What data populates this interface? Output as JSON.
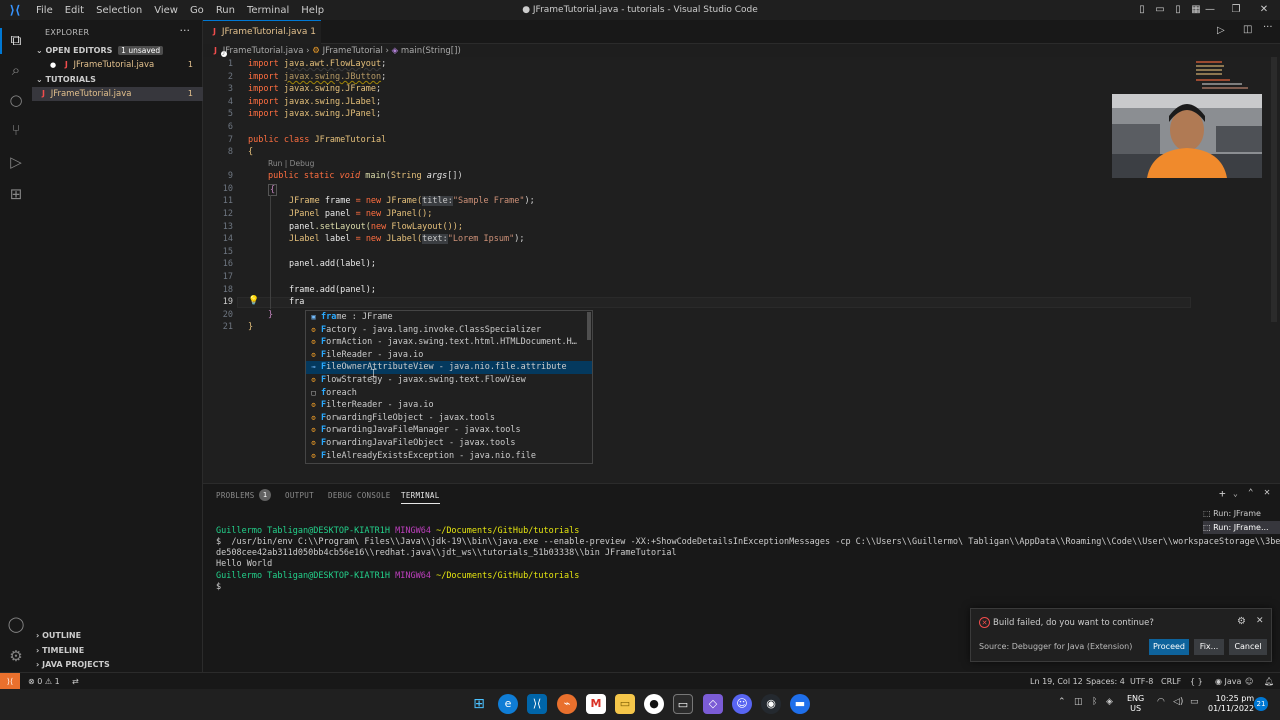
{
  "window": {
    "title": "● JFrameTutorial.java - tutorials - Visual Studio Code",
    "menu": [
      "File",
      "Edit",
      "Selection",
      "View",
      "Go",
      "Run",
      "Terminal",
      "Help"
    ]
  },
  "sidebar": {
    "header": "EXPLORER",
    "open_editors_label": "OPEN EDITORS",
    "unsaved_badge": "1 unsaved",
    "open_file": "JFrameTutorial.java",
    "open_file_problems": "1",
    "folder_label": "TUTORIALS",
    "tree_file": "JFrameTutorial.java",
    "tree_file_problems": "1",
    "outline_label": "OUTLINE",
    "timeline_label": "TIMELINE",
    "java_projects_label": "JAVA PROJECTS"
  },
  "tab": {
    "label": "JFrameTutorial.java 1"
  },
  "breadcrumbs": {
    "file": "JFrameTutorial.java",
    "class": "JFrameTutorial",
    "method": "main(String[])"
  },
  "editor": {
    "codelens": "Run | Debug",
    "lines": {
      "l1": {
        "kw": "import",
        "pkg": "java.awt.FlowLayout",
        "semi": ";"
      },
      "l2": {
        "kw": "import",
        "pkg": "javax.swing.JButton",
        "semi": ";"
      },
      "l3": {
        "kw": "import",
        "pkg": "javax.swing.JFrame",
        "semi": ";"
      },
      "l4": {
        "kw": "import",
        "pkg": "javax.swing.JLabel",
        "semi": ";"
      },
      "l5": {
        "kw": "import",
        "pkg": "javax.swing.JPanel",
        "semi": ";"
      },
      "l7": {
        "kw": "public class",
        "name": "JFrameTutorial"
      },
      "l8": "{",
      "l9": {
        "kw": "public static",
        "kw2": "void",
        "fn": "main",
        "open": "(",
        "type": "String",
        "param": "args",
        "close": "[])"
      },
      "l10": "{",
      "l11": {
        "type": "JFrame",
        "var": "frame",
        "op": "=",
        "kw": "new",
        "ctor": "JFrame(",
        "hint": "title:",
        "str": "\"Sample Frame\"",
        "end": ");"
      },
      "l12": {
        "type": "JPanel",
        "var": "panel",
        "op": "=",
        "kw": "new",
        "ctor": "JPanel();"
      },
      "l13": {
        "var": "panel",
        "call": ".setLayout(",
        "kw": "new",
        "ctor": "FlowLayout());"
      },
      "l14": {
        "type": "JLabel",
        "var": "label",
        "op": "=",
        "kw": "new",
        "ctor": "JLabel(",
        "hint": "text:",
        "str": "\"Lorem Ipsum\"",
        "end": ");"
      },
      "l16": "panel.add(label);",
      "l18": "frame.add(panel);",
      "l19": "fra",
      "l20": "}",
      "l21": "}"
    },
    "line_numbers": [
      "1",
      "2",
      "3",
      "4",
      "5",
      "6",
      "7",
      "8",
      "9",
      "10",
      "11",
      "12",
      "13",
      "14",
      "15",
      "16",
      "17",
      "18",
      "19",
      "20",
      "21"
    ]
  },
  "suggestions": [
    {
      "icon": "variable-icon",
      "match": "fra",
      "rest": "me : JFrame",
      "glyph": "▣"
    },
    {
      "icon": "class-icon",
      "match": "F",
      "rest": "actory - java.lang.invoke.ClassSpecializer",
      "glyph": "⚙"
    },
    {
      "icon": "class-icon",
      "match": "F",
      "rest": "ormAction - javax.swing.text.html.HTMLDocument.H…",
      "glyph": "⚙"
    },
    {
      "icon": "class-icon",
      "match": "F",
      "rest": "ileReader - java.io",
      "glyph": "⚙"
    },
    {
      "icon": "interface-icon",
      "match": "F",
      "rest": "ileOwnerAttributeView - java.nio.file.attribute",
      "glyph": "⊸"
    },
    {
      "icon": "class-icon",
      "match": "F",
      "rest": "lowStrategy - javax.swing.text.FlowView",
      "glyph": "⚙"
    },
    {
      "icon": "snippet-icon",
      "match": "f",
      "rest": "oreach",
      "glyph": "□"
    },
    {
      "icon": "class-icon",
      "match": "F",
      "rest": "ilterReader - java.io",
      "glyph": "⚙"
    },
    {
      "icon": "class-icon",
      "match": "F",
      "rest": "orwardingFileObject - javax.tools",
      "glyph": "⚙"
    },
    {
      "icon": "class-icon",
      "match": "F",
      "rest": "orwardingJavaFileManager - javax.tools",
      "glyph": "⚙"
    },
    {
      "icon": "class-icon",
      "match": "F",
      "rest": "orwardingJavaFileObject - javax.tools",
      "glyph": "⚙"
    },
    {
      "icon": "class-icon",
      "match": "F",
      "rest": "ileAlreadyExistsException - java.nio.file",
      "glyph": "⚙"
    }
  ],
  "panel": {
    "tabs": {
      "problems": "PROBLEMS",
      "problems_count": "1",
      "output": "OUTPUT",
      "debug": "DEBUG CONSOLE",
      "terminal": "TERMINAL"
    },
    "terminal_sessions": [
      "Run: JFrame",
      "Run: JFrame..."
    ],
    "terminal": {
      "p1_user": "Guillermo Tabligan@DESKTOP-KIATR1H",
      "p1_shell": "MINGW64",
      "p1_path": "~/Documents/GitHub/tutorials",
      "cmd1": "$  /usr/bin/env C:\\\\Program\\ Files\\\\Java\\\\jdk-19\\\\bin\\\\java.exe --enable-preview -XX:+ShowCodeDetailsInExceptionMessages -cp C:\\\\Users\\\\Guillermo\\ Tabligan\\\\AppData\\\\Roaming\\\\Code\\\\User\\\\workspaceStorage\\\\3be",
      "cmd2": "de508cee42ab311d050bb4cb56e16\\\\redhat.java\\\\jdt_ws\\\\tutorials_51b03338\\\\bin JFrameTutorial",
      "output": "Hello World",
      "p2_user": "Guillermo Tabligan@DESKTOP-KIATR1H",
      "p2_shell": "MINGW64",
      "p2_path": "~/Documents/GitHub/tutorials",
      "prompt": "$"
    }
  },
  "notification": {
    "message": "Build failed, do you want to continue?",
    "source": "Source: Debugger for Java (Extension)",
    "proceed": "Proceed",
    "fix": "Fix...",
    "cancel": "Cancel"
  },
  "statusbar": {
    "errors": "0",
    "warnings": "1",
    "position": "Ln 19, Col 12",
    "spaces": "Spaces: 4",
    "encoding": "UTF-8",
    "eol": "CRLF",
    "language": "Java"
  },
  "taskbar": {
    "lang": "ENG",
    "region": "US",
    "time": "10:25 pm",
    "date": "01/11/2022",
    "notif_count": "21"
  },
  "colors": {
    "accent": "#0078d4",
    "error": "#f14c4c",
    "modified": "#e2c08d"
  }
}
